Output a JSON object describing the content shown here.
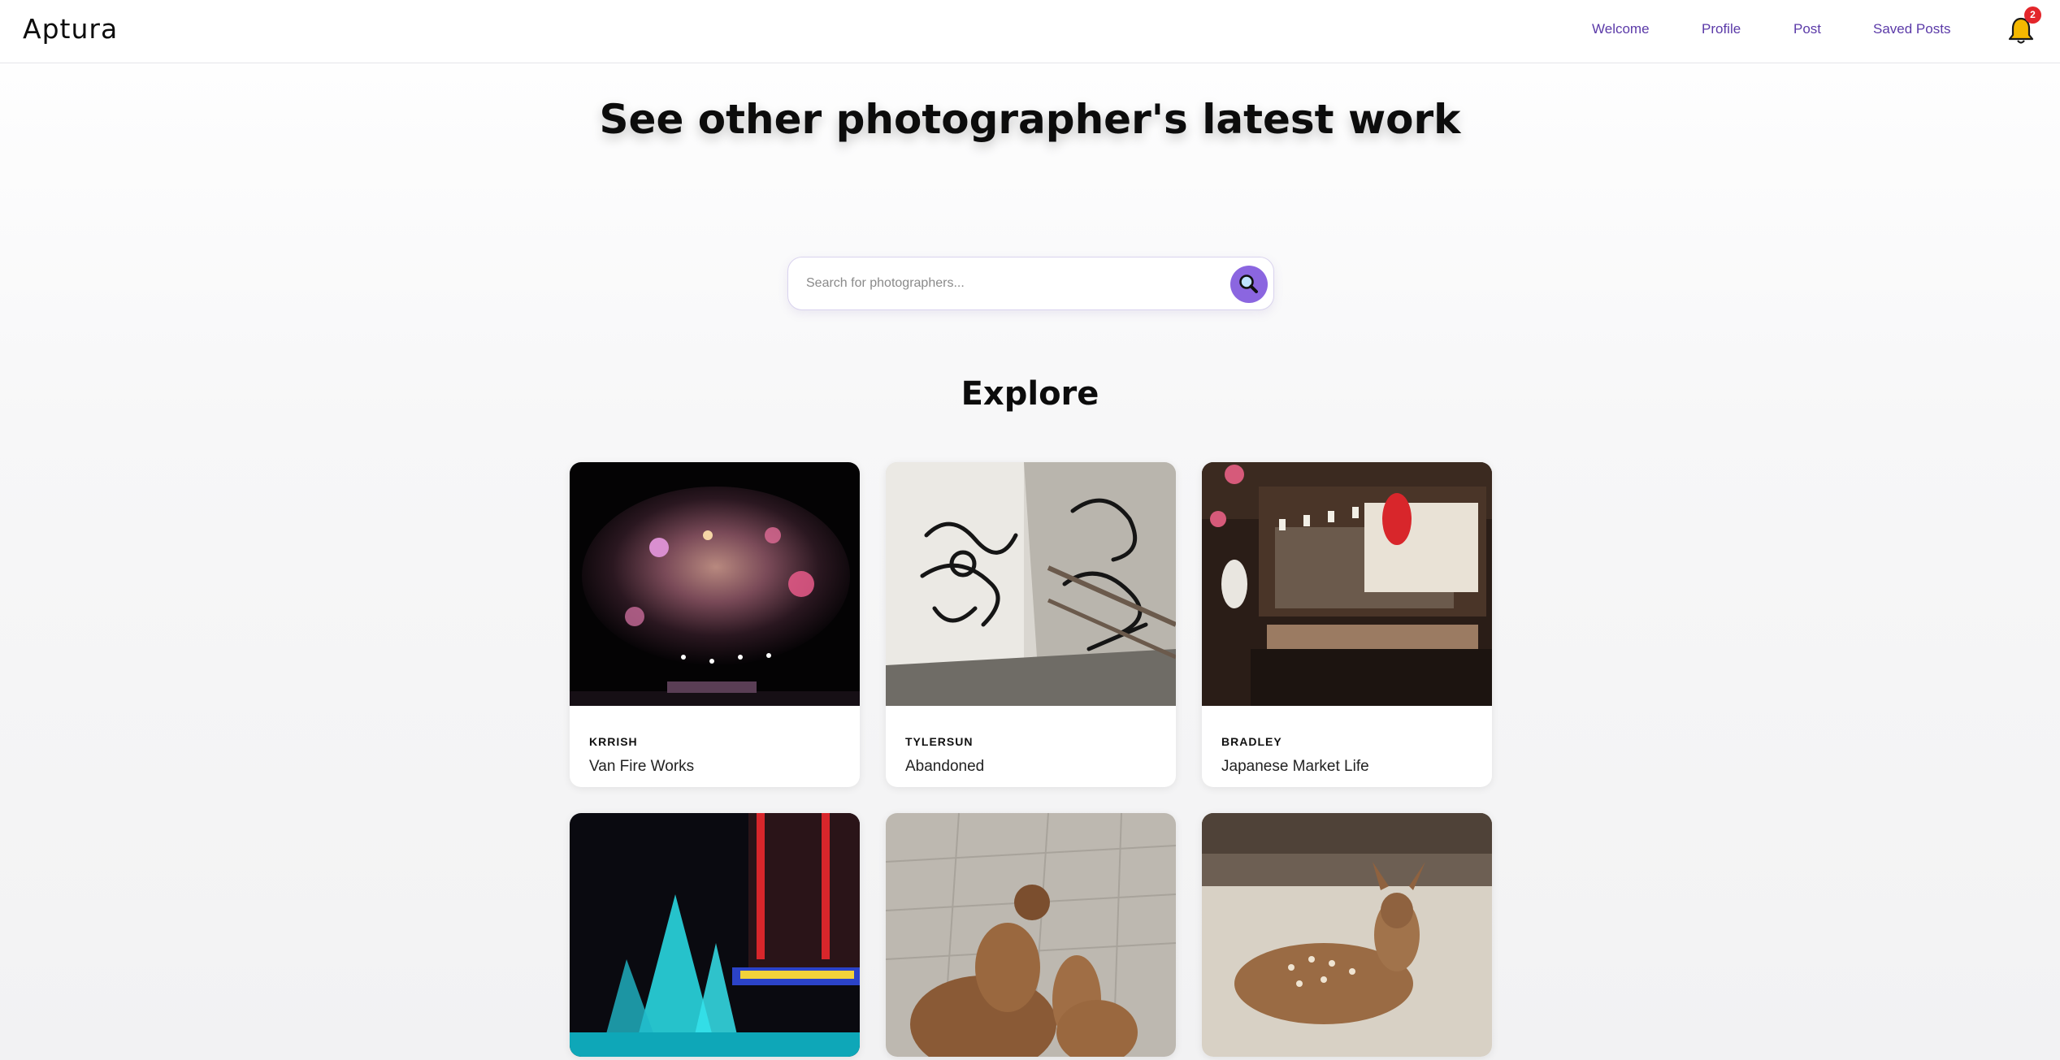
{
  "header": {
    "logo": "Aptura",
    "nav": [
      "Welcome",
      "Profile",
      "Post",
      "Saved Posts"
    ],
    "notification_count": "2"
  },
  "hero": {
    "title": "See other photographer's latest work"
  },
  "search": {
    "placeholder": "Search for photographers..."
  },
  "explore": {
    "title": "Explore",
    "cards": [
      {
        "author": "KRRISH",
        "title": "Van Fire Works",
        "image": "fireworks-photo"
      },
      {
        "author": "TYLERSUN",
        "title": "Abandoned",
        "image": "graffiti-photo"
      },
      {
        "author": "BRADLEY",
        "title": "Japanese Market Life",
        "image": "market-photo"
      },
      {
        "author": "",
        "title": "",
        "image": "fountain-photo"
      },
      {
        "author": "",
        "title": "",
        "image": "deer-pair-photo"
      },
      {
        "author": "",
        "title": "",
        "image": "resting-deer-photo"
      }
    ]
  },
  "colors": {
    "accent": "#8b66e0",
    "nav_link": "#5b3aa8",
    "badge": "#e3262b",
    "bell": "#f5b800"
  }
}
